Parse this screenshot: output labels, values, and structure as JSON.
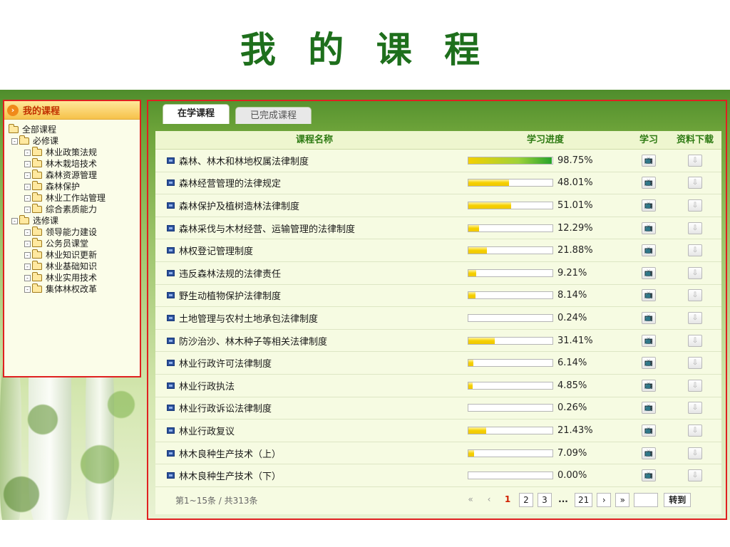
{
  "page": {
    "title": "我 的 课 程"
  },
  "sidebar": {
    "header": "我的课程",
    "tree": [
      {
        "label": "全部课程",
        "level": 0,
        "toggle": ""
      },
      {
        "label": "必修课",
        "level": 1,
        "toggle": "-"
      },
      {
        "label": "林业政策法规",
        "level": 2,
        "toggle": "-"
      },
      {
        "label": "林木栽培技术",
        "level": 2,
        "toggle": "-"
      },
      {
        "label": "森林资源管理",
        "level": 2,
        "toggle": "-"
      },
      {
        "label": "森林保护",
        "level": 2,
        "toggle": "-"
      },
      {
        "label": "林业工作站管理",
        "level": 2,
        "toggle": "-"
      },
      {
        "label": "综合素质能力",
        "level": 2,
        "toggle": "-"
      },
      {
        "label": "选修课",
        "level": 1,
        "toggle": "-"
      },
      {
        "label": "领导能力建设",
        "level": 2,
        "toggle": "-"
      },
      {
        "label": "公务员课堂",
        "level": 2,
        "toggle": "-"
      },
      {
        "label": "林业知识更新",
        "level": 2,
        "toggle": "-"
      },
      {
        "label": "林业基础知识",
        "level": 2,
        "toggle": "-"
      },
      {
        "label": "林业实用技术",
        "level": 2,
        "toggle": "-"
      },
      {
        "label": "集体林权改革",
        "level": 2,
        "toggle": "-"
      }
    ]
  },
  "tabs": [
    {
      "label": "在学课程",
      "active": true
    },
    {
      "label": "已完成课程",
      "active": false
    }
  ],
  "table": {
    "headers": {
      "name": "课程名称",
      "progress": "学习进度",
      "study": "学习",
      "download": "资料下载"
    },
    "rows": [
      {
        "name": "森林、林木和林地权属法律制度",
        "progress": 98.75,
        "progress_text": "98.75%"
      },
      {
        "name": "森林经营管理的法律规定",
        "progress": 48.01,
        "progress_text": "48.01%"
      },
      {
        "name": "森林保护及植树造林法律制度",
        "progress": 51.01,
        "progress_text": "51.01%"
      },
      {
        "name": "森林采伐与木材经营、运输管理的法律制度",
        "progress": 12.29,
        "progress_text": "12.29%"
      },
      {
        "name": "林权登记管理制度",
        "progress": 21.88,
        "progress_text": "21.88%"
      },
      {
        "name": "违反森林法规的法律责任",
        "progress": 9.21,
        "progress_text": "9.21%"
      },
      {
        "name": "野生动植物保护法律制度",
        "progress": 8.14,
        "progress_text": "8.14%"
      },
      {
        "name": "土地管理与农村土地承包法律制度",
        "progress": 0.24,
        "progress_text": "0.24%"
      },
      {
        "name": "防沙治沙、林木种子等相关法律制度",
        "progress": 31.41,
        "progress_text": "31.41%"
      },
      {
        "name": "林业行政许可法律制度",
        "progress": 6.14,
        "progress_text": "6.14%"
      },
      {
        "name": "林业行政执法",
        "progress": 4.85,
        "progress_text": "4.85%"
      },
      {
        "name": "林业行政诉讼法律制度",
        "progress": 0.26,
        "progress_text": "0.26%"
      },
      {
        "name": "林业行政复议",
        "progress": 21.43,
        "progress_text": "21.43%"
      },
      {
        "name": "林木良种生产技术（上）",
        "progress": 7.09,
        "progress_text": "7.09%"
      },
      {
        "name": "林木良种生产技术（下）",
        "progress": 0.0,
        "progress_text": "0.00%"
      }
    ]
  },
  "pager": {
    "info": "第1~15条 / 共313条",
    "first": "«",
    "prev": "‹",
    "pages": [
      "1",
      "2",
      "3"
    ],
    "current": "1",
    "ellipsis": "...",
    "last_page": "21",
    "next": "›",
    "last": "»",
    "goto_value": "",
    "goto_label": "转到"
  },
  "icons": {
    "study": "tv-icon",
    "download": "download-arrow-icon",
    "course": "film-icon",
    "header": "arrow-right-circle-icon"
  },
  "colors": {
    "title": "#1e6f1c",
    "header_text": "#2d7a12",
    "highlight_border": "#e02020",
    "progress_fill": "#f5d000"
  }
}
